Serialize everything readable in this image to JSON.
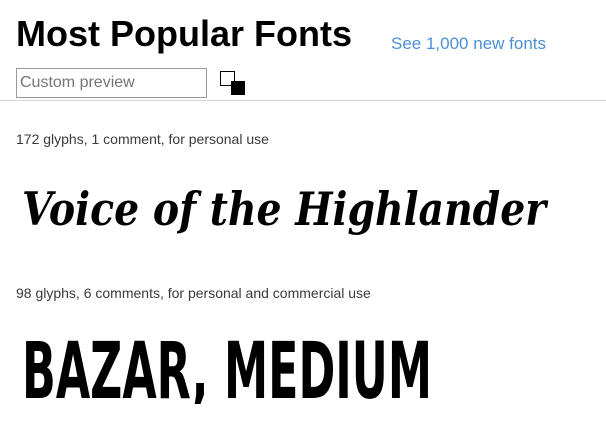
{
  "header": {
    "title": "Most Popular Fonts",
    "new_fonts_link": "See 1,000 new fonts"
  },
  "toolbar": {
    "preview_placeholder": "Custom preview",
    "preview_value": "",
    "colors": {
      "background": "#ffffff",
      "foreground": "#000000"
    }
  },
  "fonts": [
    {
      "meta": "172 glyphs, 1 comment, for personal use",
      "sample": "Voice of the Highlander"
    },
    {
      "meta": "98 glyphs, 6 comments, for personal and commercial use",
      "sample": "BAZAR, MEDIUM"
    }
  ],
  "colors": {
    "link": "#4d90d6",
    "text": "#3a3a3a",
    "divider": "#d6d6d6"
  }
}
